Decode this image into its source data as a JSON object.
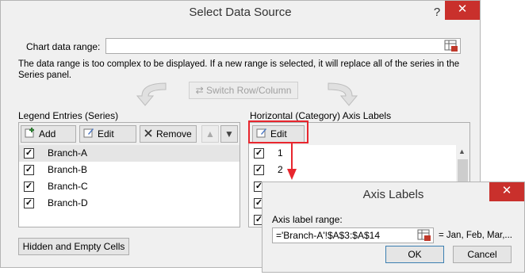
{
  "dialog": {
    "title": "Select Data Source",
    "help": "?",
    "close": "✕",
    "chart_range_label": "Chart data range:",
    "chart_range_value": "",
    "message": "The data range is too complex to be displayed. If a new range is selected, it will replace all of the series in the Series panel.",
    "switch_label": "Switch Row/Column",
    "legend_label": "Legend Entries (Series)",
    "axis_label": "Horizontal (Category) Axis Labels",
    "hidden_cells_label": "Hidden and Empty Cells"
  },
  "legend": {
    "add": "Add",
    "edit": "Edit",
    "remove": "Remove",
    "series": [
      {
        "name": "Branch-A",
        "checked": true,
        "selected": true
      },
      {
        "name": "Branch-B",
        "checked": true,
        "selected": false
      },
      {
        "name": "Branch-C",
        "checked": true,
        "selected": false
      },
      {
        "name": "Branch-D",
        "checked": true,
        "selected": false
      }
    ]
  },
  "axis": {
    "edit": "Edit",
    "items": [
      "1",
      "2",
      "",
      "",
      ""
    ]
  },
  "axis_dialog": {
    "title": "Axis Labels",
    "close": "✕",
    "range_label": "Axis label range:",
    "range_value": "='Branch-A'!$A$3:$A$14",
    "preview": "= Jan, Feb, Mar,...",
    "ok": "OK",
    "cancel": "Cancel"
  },
  "colors": {
    "close_red": "#c9302c",
    "highlight_red": "#e8262e"
  }
}
